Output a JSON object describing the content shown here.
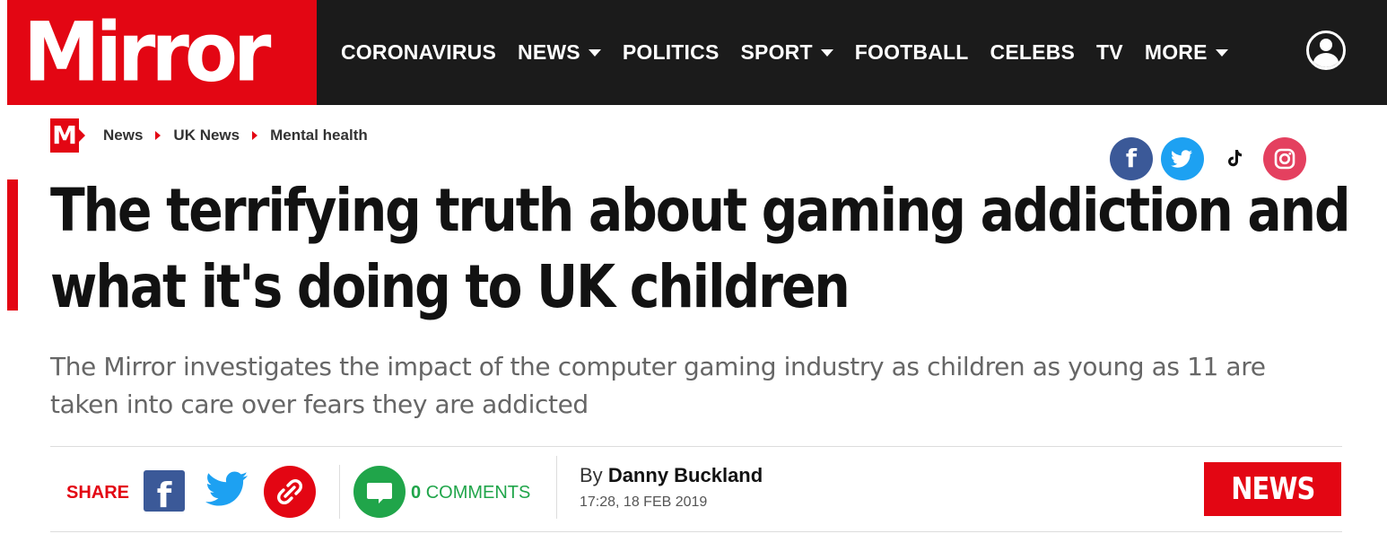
{
  "header": {
    "logo_text": "Mirror",
    "nav": [
      {
        "label": "CORONAVIRUS",
        "has_dropdown": false
      },
      {
        "label": "NEWS",
        "has_dropdown": true
      },
      {
        "label": "POLITICS",
        "has_dropdown": false
      },
      {
        "label": "SPORT",
        "has_dropdown": true
      },
      {
        "label": "FOOTBALL",
        "has_dropdown": false
      },
      {
        "label": "CELEBS",
        "has_dropdown": false
      },
      {
        "label": "TV",
        "has_dropdown": false
      },
      {
        "label": "MORE",
        "has_dropdown": true
      }
    ],
    "account_icon": "user-account-icon"
  },
  "breadcrumb": {
    "logo_text": "M",
    "items": [
      "News",
      "UK News",
      "Mental health"
    ]
  },
  "follow_icons": [
    "facebook-icon",
    "twitter-icon",
    "tiktok-icon",
    "instagram-icon"
  ],
  "article": {
    "headline_line1": "The terrifying truth about gaming addiction and",
    "headline_line2": "what it's doing to UK children",
    "standfirst": "The Mirror investigates the impact of the computer gaming industry as children as young as 11 are taken into care over fears they are addicted",
    "share_label": "SHARE",
    "comments_count": "0",
    "comments_label": "COMMENTS",
    "byline_prefix": "By",
    "author": "Danny Buckland",
    "date": "17:28, 18 FEB 2019",
    "section_badge": "NEWS"
  },
  "colors": {
    "brand_red": "#e30613",
    "nav_bg": "#1b1b1b",
    "facebook": "#3b5998",
    "twitter": "#1da1f2",
    "instagram": "#e4405f",
    "comments_green": "#20a54a"
  }
}
